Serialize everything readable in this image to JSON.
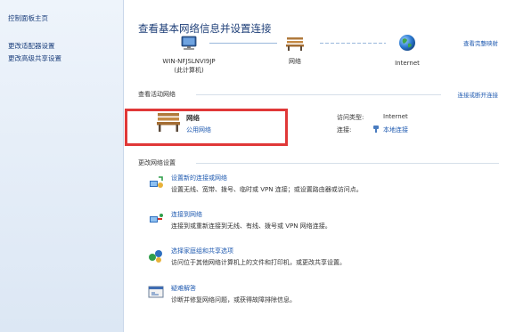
{
  "sidebar": {
    "items": [
      {
        "label": "控制面板主页"
      },
      {
        "label": "更改适配器设置"
      },
      {
        "label": "更改高级共享设置"
      }
    ]
  },
  "header": {
    "title": "查看基本网络信息并设置连接",
    "full_map_link": "查看完整映射"
  },
  "map": {
    "computer_name": "WIN-NFJSLNVI9JP",
    "computer_sub": "(此计算机)",
    "network_label": "网络",
    "internet_label": "Internet"
  },
  "active_networks": {
    "heading": "查看活动网络",
    "connect_link": "连接或断开连接",
    "network_name": "网络",
    "network_type": "公用网络",
    "access_type_label": "访问类型:",
    "access_type_value": "Internet",
    "connections_label": "连接:",
    "connections_value": "本地连接"
  },
  "change_settings": {
    "heading": "更改网络设置",
    "tasks": [
      {
        "title": "设置新的连接或网络",
        "desc": "设置无线、宽带、拨号、临时或 VPN 连接；或设置路由器或访问点。",
        "icon": "new-connection-icon"
      },
      {
        "title": "连接到网络",
        "desc": "连接到或重新连接到无线、有线、拨号或 VPN 网络连接。",
        "icon": "connect-network-icon"
      },
      {
        "title": "选择家庭组和共享选项",
        "desc": "访问位于其他网络计算机上的文件和打印机，或更改共享设置。",
        "icon": "homegroup-icon"
      },
      {
        "title": "疑难解答",
        "desc": "诊断并修复网络问题，或获得故障排除信息。",
        "icon": "troubleshoot-icon"
      }
    ]
  },
  "colors": {
    "link": "#1f5ab0",
    "title": "#1e3f78",
    "highlight_box": "#e03838"
  }
}
